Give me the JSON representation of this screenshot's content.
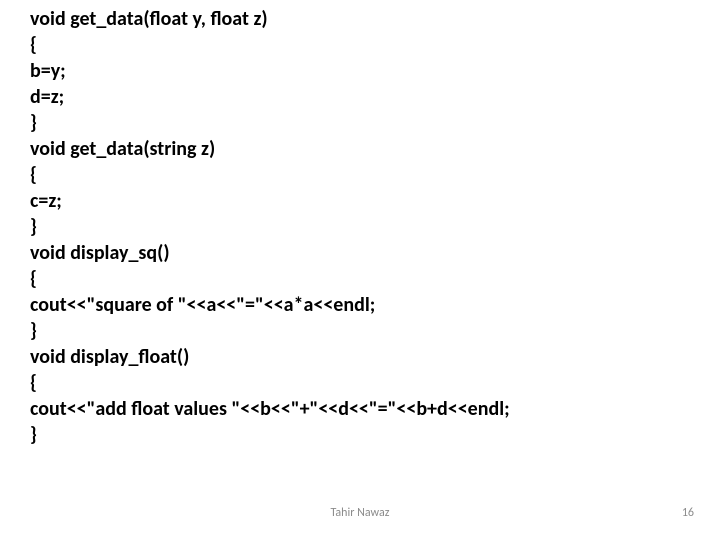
{
  "code": {
    "l1": "void get_data(float y, float z)",
    "l2": "{",
    "l3": "b=y;",
    "l4": "d=z;",
    "l5": "}",
    "l6": "void get_data(string z)",
    "l7": "{",
    "l8": "c=z;",
    "l9": "}",
    "l10": "void display_sq()",
    "l11": "{",
    "l12": "cout<<\"square of \"<<a<<\"=\"<<a*a<<endl;",
    "l13": "}",
    "l14": "void display_float()",
    "l15": "{",
    "l16": "cout<<\"add float values \"<<b<<\"+\"<<d<<\"=\"<<b+d<<endl;",
    "l17": "}"
  },
  "footer": {
    "author": "Tahir Nawaz",
    "page": "16"
  }
}
